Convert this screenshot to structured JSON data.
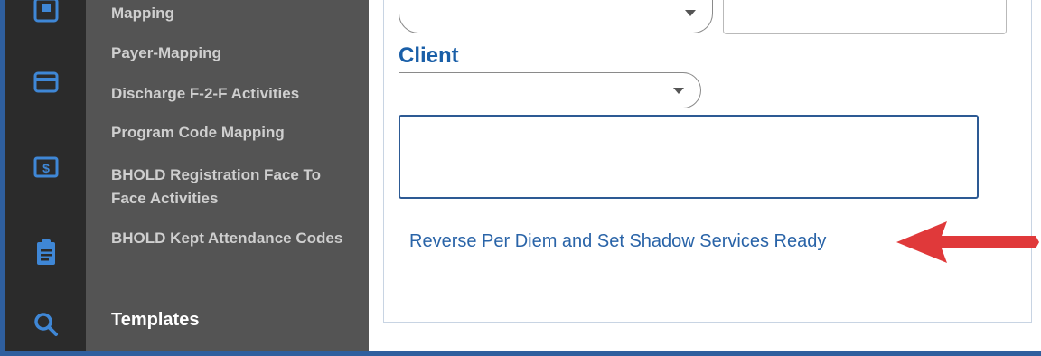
{
  "sidebar": {
    "icons": [
      {
        "name": "window-icon"
      },
      {
        "name": "credit-card-icon"
      },
      {
        "name": "dollar-icon"
      },
      {
        "name": "clipboard-icon"
      },
      {
        "name": "search-icon"
      }
    ],
    "items": [
      {
        "label": "Mapping"
      },
      {
        "label": "Payer-Mapping"
      },
      {
        "label": "Discharge F-2-F Activities"
      },
      {
        "label": "Program Code Mapping"
      },
      {
        "label": "BHOLD Registration Face To Face Activities"
      },
      {
        "label": "BHOLD Kept Attendance Codes"
      },
      {
        "label": "Templates"
      }
    ]
  },
  "form": {
    "client_label": "Client",
    "top_select_value": "",
    "top_text_value": "",
    "client_select_value": "",
    "client_text_value": ""
  },
  "action": {
    "link_label": "Reverse Per Diem and Set Shadow Services Ready"
  },
  "colors": {
    "accent": "#1a5fa8",
    "rail": "#2b2b2b",
    "menu": "#545454",
    "arrow": "#e0393a"
  }
}
